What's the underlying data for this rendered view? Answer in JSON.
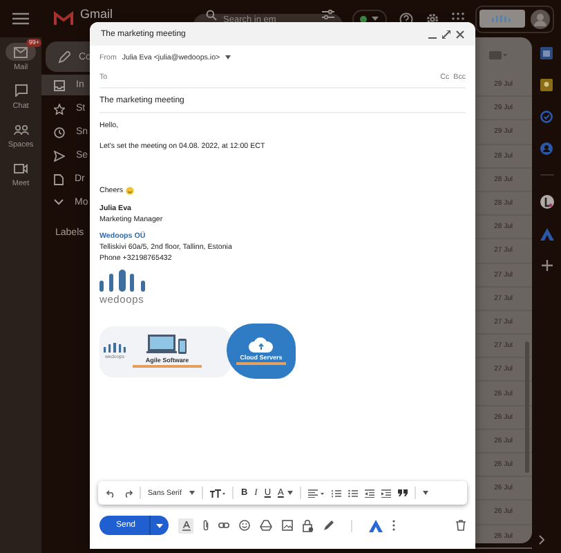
{
  "top_bar": {
    "product": "Gmail",
    "search": {
      "placeholder": "Search in em"
    }
  },
  "rail": [
    {
      "label": "Mail",
      "selected": true,
      "badge": "99+"
    },
    {
      "label": "Chat",
      "selected": false
    },
    {
      "label": "Spaces",
      "selected": false
    },
    {
      "label": "Meet",
      "selected": false
    }
  ],
  "sidebar": {
    "compose": "Co",
    "items": [
      {
        "label": "In",
        "selected": true
      },
      {
        "label": "St",
        "selected": false
      },
      {
        "label": "Sn",
        "selected": false
      },
      {
        "label": "Se",
        "selected": false
      },
      {
        "label": "Dr",
        "selected": false
      },
      {
        "label": "Mo",
        "selected": false
      }
    ],
    "labels_heading": "Labels"
  },
  "mail_list": {
    "rows": [
      {
        "date": "29 Jul"
      },
      {
        "date": "29 Jul"
      },
      {
        "date": "29 Jul"
      },
      {
        "date": "28 Jul"
      },
      {
        "date": "28 Jul"
      },
      {
        "date": "28 Jul"
      },
      {
        "date": "28 Jul"
      },
      {
        "date": "27 Jul"
      },
      {
        "date": "27 Jul"
      },
      {
        "date": "27 Jul"
      },
      {
        "date": "27 Jul"
      },
      {
        "date": "27 Jul"
      },
      {
        "date": "27 Jul"
      },
      {
        "date": "26 Jul"
      },
      {
        "date": "26 Jul"
      },
      {
        "date": "26 Jul"
      },
      {
        "date": "26 Jul"
      },
      {
        "date": "26 Jul"
      },
      {
        "date": "26 Jul"
      },
      {
        "date": "26 Jul"
      }
    ]
  },
  "compose": {
    "title": "The marketing meeting",
    "from_label": "From",
    "from": "Julia Eva <julia@wedoops.io>",
    "to_label": "To",
    "cc": "Cc",
    "bcc": "Bcc",
    "subject": "The marketing meeting",
    "body": [
      "Hello,",
      "Let's set the meeting on 04.08. 2022, at 12:00 ECT"
    ],
    "closing": "Cheers",
    "signature": {
      "name": "Julia Eva",
      "title": "Marketing Manager",
      "company": "Wedoops OÜ",
      "address": "Telliskivi 60a/5, 2nd floor, Tallinn, Estonia",
      "phone": "Phone +32198765432",
      "logo_text": "wedoops"
    },
    "banner": {
      "logo_text": "wedoops",
      "items": [
        {
          "title": "Agile Software"
        },
        {
          "title": "Cloud Servers"
        }
      ]
    },
    "format_bar": {
      "font": "Sans Serif",
      "bold": "B",
      "italic": "I",
      "underline": "U",
      "text_color_label": "A"
    },
    "send": "Send"
  }
}
